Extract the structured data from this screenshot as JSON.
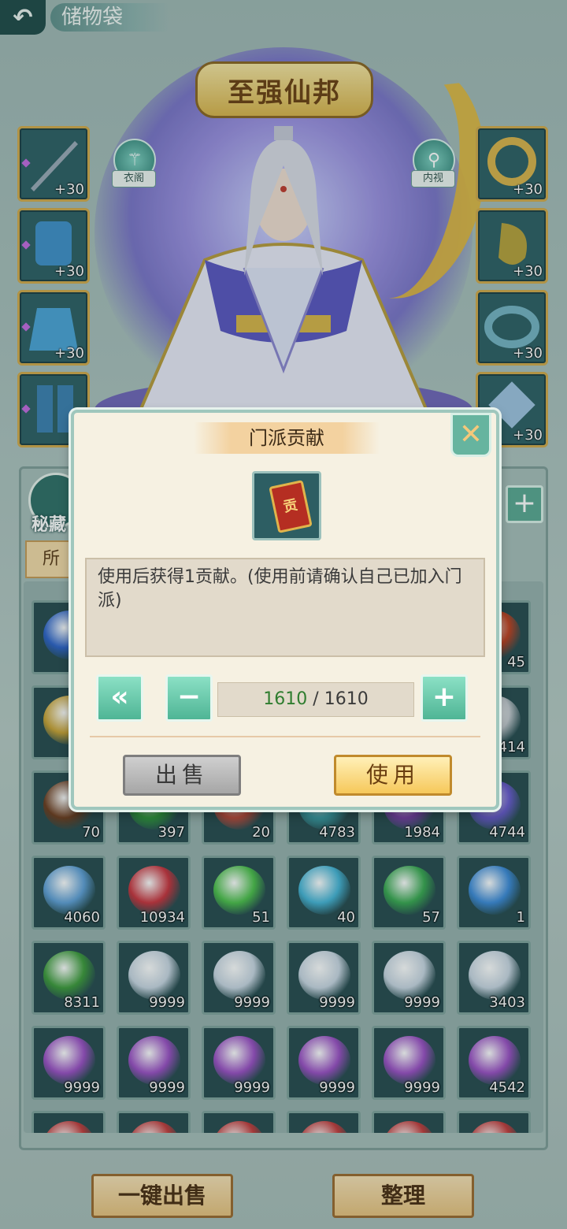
{
  "header": {
    "title": "储物袋"
  },
  "hero": {
    "banner": "至强仙邦",
    "wardrobe_label": "衣阁",
    "inspect_label": "内视",
    "equip_left": [
      {
        "level": "+30",
        "color": "#9aa9b6"
      },
      {
        "level": "+30",
        "color": "#3f8fc9"
      },
      {
        "level": "+30",
        "color": "#4aa3d6"
      },
      {
        "level": "",
        "color": "#3b7fb0"
      }
    ],
    "equip_right": [
      {
        "level": "+30",
        "color": "#d9b34a"
      },
      {
        "level": "+30",
        "color": "#b6a03a"
      },
      {
        "level": "+30",
        "color": "#74b3c3"
      },
      {
        "level": "+30",
        "color": "#9ec3e0"
      }
    ]
  },
  "inventory": {
    "tab_label": "秘藏",
    "filter_label": "所",
    "slots": [
      {
        "qty": "",
        "color": "#2c62c8"
      },
      {
        "qty": "",
        "color": "#264a4e"
      },
      {
        "qty": "",
        "color": "#264a4e"
      },
      {
        "qty": "",
        "color": "#264a4e"
      },
      {
        "qty": "",
        "color": "#264a4e"
      },
      {
        "qty": "45",
        "color": "#c2401f"
      },
      {
        "qty": "",
        "color": "#c9a233"
      },
      {
        "qty": "",
        "color": "#264a4e"
      },
      {
        "qty": "",
        "color": "#264a4e"
      },
      {
        "qty": "",
        "color": "#264a4e"
      },
      {
        "qty": "",
        "color": "#264a4e"
      },
      {
        "qty": "414",
        "color": "#c8cdd2"
      },
      {
        "qty": "70",
        "color": "#6b3a1c"
      },
      {
        "qty": "397",
        "color": "#2f9a3a"
      },
      {
        "qty": "20",
        "color": "#c24a3a"
      },
      {
        "qty": "4783",
        "color": "#3aa0a8"
      },
      {
        "qty": "1984",
        "color": "#7a3fa8"
      },
      {
        "qty": "4744",
        "color": "#6a5ad0"
      },
      {
        "qty": "4060",
        "color": "#5f9fd6"
      },
      {
        "qty": "10934",
        "color": "#c8323c"
      },
      {
        "qty": "51",
        "color": "#4cbf4a"
      },
      {
        "qty": "40",
        "color": "#45b4d6"
      },
      {
        "qty": "57",
        "color": "#39a850"
      },
      {
        "qty": "1",
        "color": "#3c8ad8"
      },
      {
        "qty": "8311",
        "color": "#3d9a3a"
      },
      {
        "qty": "9999",
        "color": "#c9d6e2"
      },
      {
        "qty": "9999",
        "color": "#c9d6e2"
      },
      {
        "qty": "9999",
        "color": "#c9d6e2"
      },
      {
        "qty": "9999",
        "color": "#c9d6e2"
      },
      {
        "qty": "3403",
        "color": "#c9d6e2"
      },
      {
        "qty": "9999",
        "color": "#9b4fc4"
      },
      {
        "qty": "9999",
        "color": "#9b4fc4"
      },
      {
        "qty": "9999",
        "color": "#9b4fc4"
      },
      {
        "qty": "9999",
        "color": "#9b4fc4"
      },
      {
        "qty": "9999",
        "color": "#9b4fc4"
      },
      {
        "qty": "4542",
        "color": "#9b4fc4"
      },
      {
        "qty": "",
        "color": "#c23a3a"
      },
      {
        "qty": "",
        "color": "#c23a3a"
      },
      {
        "qty": "",
        "color": "#c23a3a"
      },
      {
        "qty": "",
        "color": "#c23a3a"
      },
      {
        "qty": "",
        "color": "#c23a3a"
      },
      {
        "qty": "",
        "color": "#c23a3a"
      }
    ]
  },
  "dialog": {
    "title": "门派贡献",
    "item_glyph": "贡",
    "description": "使用后获得1贡献。(使用前请确认自己已加入门派)",
    "count_current": "1610",
    "count_sep": " / ",
    "count_max": "1610",
    "btn_max": "«",
    "btn_minus": "−",
    "btn_plus": "+",
    "close": "✕",
    "sell_label": "出售",
    "use_label": "使用"
  },
  "footer": {
    "sell_all_label": "一键出售",
    "sort_label": "整理"
  }
}
